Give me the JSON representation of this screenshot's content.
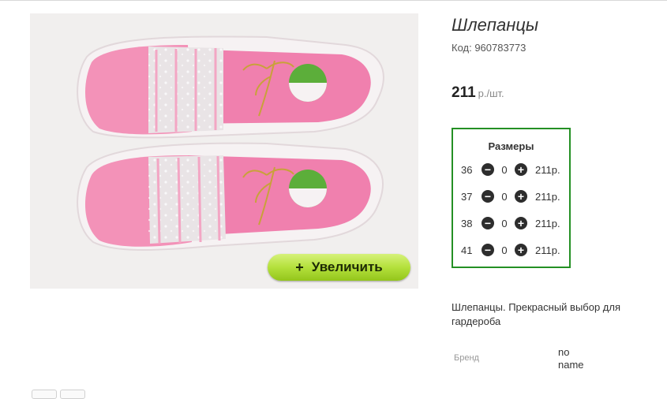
{
  "product": {
    "title": "Шлепанцы",
    "code": "Код: 960783773",
    "price": "211",
    "price_unit": "р./шт.",
    "description": "Шлепанцы. Прекрасный выбор для гардероба"
  },
  "image": {
    "alt": "Шлепанцы розовые",
    "zoom_label": "Увеличить",
    "zoom_plus": "+"
  },
  "sizes": {
    "title": "Размеры",
    "minus_icon": "minus-circle-icon",
    "plus_icon": "plus-circle-icon",
    "rows": [
      {
        "size": "36",
        "qty": "0",
        "price": "211р."
      },
      {
        "size": "37",
        "qty": "0",
        "price": "211р."
      },
      {
        "size": "38",
        "qty": "0",
        "price": "211р."
      },
      {
        "size": "41",
        "qty": "0",
        "price": "211р."
      }
    ]
  },
  "attributes": {
    "brand_label": "Бренд",
    "brand_value": "no name"
  },
  "colors": {
    "sizes_border": "#249024",
    "zoom_button": "#b4e13c",
    "slipper_pink": "#ee86ad"
  }
}
